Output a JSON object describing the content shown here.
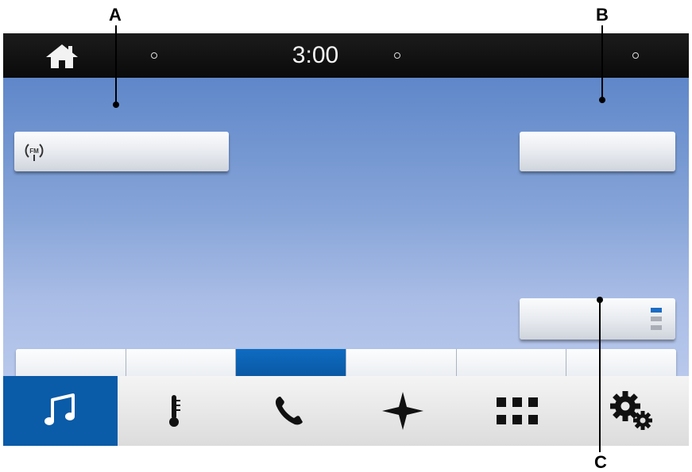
{
  "callouts": {
    "a": "A",
    "b": "B",
    "c": "C"
  },
  "status_bar": {
    "time": "3:00",
    "home_icon": "home-icon",
    "indicator_dots": 3
  },
  "source_button": {
    "icon": "fm-radio-icon",
    "icon_text": "FM",
    "label": ""
  },
  "top_right_button": {
    "label": ""
  },
  "presets_button": {
    "icon": "preset-pages-icon",
    "page_colors": [
      "#1b6cc3",
      "#a9aeb6",
      "#a9aeb6"
    ]
  },
  "presets": [
    {
      "label": "",
      "active": false
    },
    {
      "label": "",
      "active": false
    },
    {
      "label": "",
      "active": true
    },
    {
      "label": "",
      "active": false
    },
    {
      "label": "",
      "active": false
    },
    {
      "label": "",
      "active": false
    }
  ],
  "nav": {
    "items": [
      {
        "name": "audio",
        "icon": "music-note-icon",
        "active": true
      },
      {
        "name": "climate",
        "icon": "thermometer-icon",
        "active": false
      },
      {
        "name": "phone",
        "icon": "phone-icon",
        "active": false
      },
      {
        "name": "navigation",
        "icon": "navigation-star-icon",
        "active": false
      },
      {
        "name": "apps",
        "icon": "apps-grid-icon",
        "active": false
      },
      {
        "name": "settings",
        "icon": "gears-icon",
        "active": false
      }
    ]
  },
  "colors": {
    "accent": "#0a5ba8",
    "background_top": "#5f87c9",
    "background_bottom": "#b8c8ec"
  }
}
